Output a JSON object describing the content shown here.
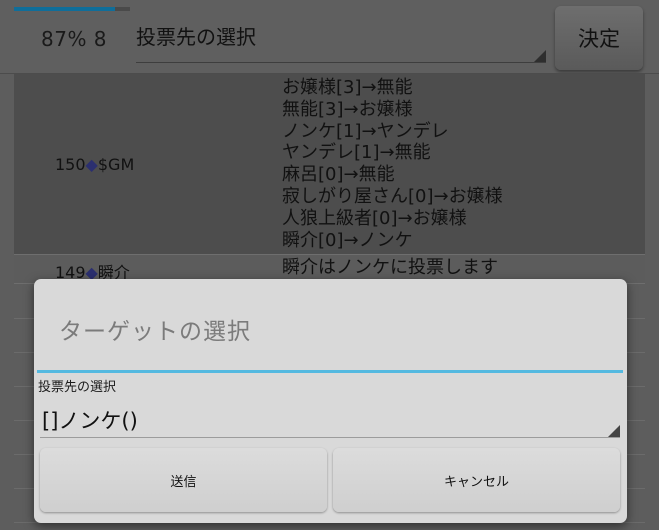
{
  "header": {
    "progress_percent": 87,
    "status_text": "87% 8",
    "vote_selector_label": "投票先の選択",
    "decide_button": "決定"
  },
  "log": [
    {
      "name_prefix": "150",
      "name_suffix": "$GM",
      "lines": [
        "お嬢様[3]→無能",
        "無能[3]→お嬢様",
        "ノンケ[1]→ヤンデレ",
        "ヤンデレ[1]→無能",
        "麻呂[0]→無能",
        "寂しがり屋さん[0]→お嬢様",
        "人狼上級者[0]→お嬢様",
        "瞬介[0]→ノンケ"
      ]
    },
    {
      "name_prefix": "149",
      "name_suffix": "瞬介",
      "lines": [
        "瞬介はノンケに投票します"
      ]
    }
  ],
  "dialog": {
    "title": "ターゲットの選択",
    "field_label": "投票先の選択",
    "selected_value": "[]ノンケ()",
    "send_button": "送信",
    "cancel_button": "キャンセル"
  },
  "icons": {
    "name_marker": "diamond-icon",
    "dropdown": "spinner-arrow-icon"
  },
  "colors": {
    "progress": "#0f6e9a",
    "dialog_accent": "#54b9e0",
    "name_marker": "#2b2f6f"
  }
}
